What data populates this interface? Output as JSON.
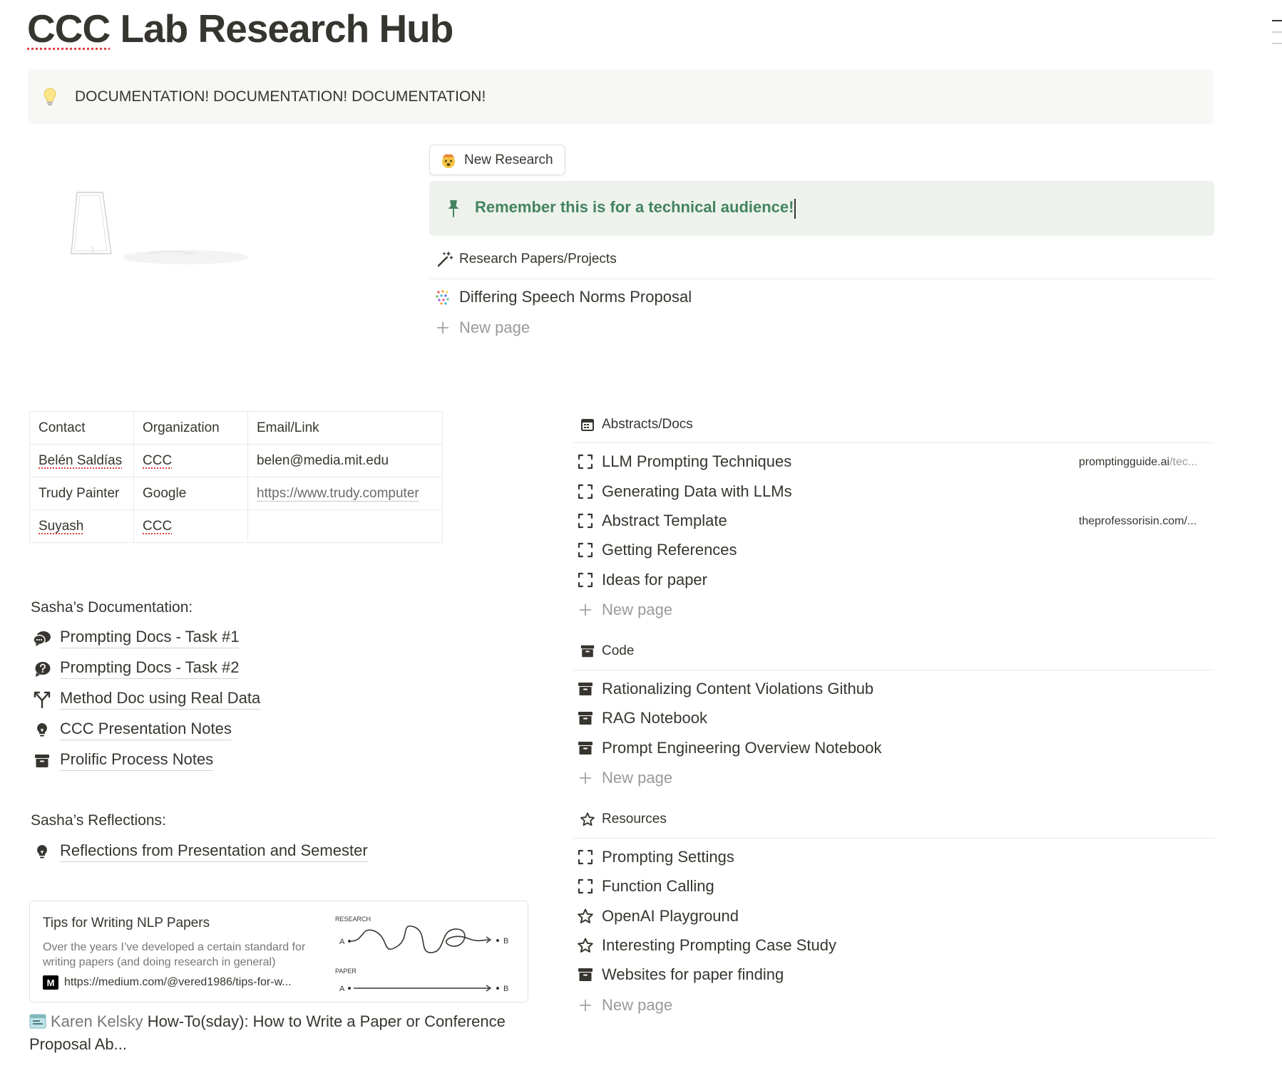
{
  "page": {
    "title_first_word": "CCC",
    "title_rest": " Lab Research Hub"
  },
  "callout_doc": {
    "icon": "lightbulb-icon",
    "text": "DOCUMENTATION! DOCUMENTATION! DOCUMENTATION!"
  },
  "new_research_button": {
    "icon": "exploding-head-emoji-icon",
    "label": "New Research"
  },
  "callout_note": {
    "icon": "pushpin-icon",
    "text": "Remember this is for a technical audience!",
    "color": "#448361",
    "background": "#edf3ec"
  },
  "research_papers": {
    "header": "Research Papers/Projects",
    "icon": "magic-wand-icon",
    "items": [
      {
        "label": "Differing Speech Norms Proposal",
        "icon": "colorful-dots-icon"
      }
    ],
    "new_page_label": "New page"
  },
  "contacts_table": {
    "headers": [
      "Contact",
      "Organization",
      "Email/Link"
    ],
    "rows": [
      [
        "Belén Saldías",
        "CCC",
        "belen@media.mit.edu"
      ],
      [
        "Trudy Painter",
        "Google",
        "https://www.trudy.computer"
      ],
      [
        "Suyash",
        "CCC",
        ""
      ]
    ]
  },
  "sasha_docs": {
    "label": "Sasha’s Documentation:",
    "items": [
      {
        "label": "Prompting Docs - Task #1",
        "icon": "chat-bubbles-icon"
      },
      {
        "label": "Prompting Docs - Task #2",
        "icon": "question-bubble-icon"
      },
      {
        "label": "Method Doc using Real Data",
        "icon": "fork-arrow-icon"
      },
      {
        "label": "CCC Presentation Notes",
        "icon": "lightbulb-icon"
      },
      {
        "label": "Prolific Process Notes",
        "icon": "archive-box-icon"
      }
    ]
  },
  "sasha_reflections": {
    "label": "Sasha’s Reflections:",
    "items": [
      {
        "label": "Reflections from Presentation and Semester",
        "icon": "lightbulb-icon"
      }
    ]
  },
  "bookmark": {
    "title": "Tips for Writing NLP Papers",
    "description": "Over the years I’ve developed a certain standard for writing papers (and doing research in general)",
    "favicon": "M",
    "url": "https://medium.com/@vered1986/tips-for-w...",
    "image_label_research": "RESEARCH",
    "image_label_paper": "PAPER",
    "point_a": "A",
    "point_b": "B"
  },
  "mention": {
    "icon": "calendar-page-icon",
    "author": "Karen Kelsky",
    "title": "How-To(sday): How to Write a Paper or Conference Proposal Ab..."
  },
  "abstracts": {
    "header": "Abstracts/Docs",
    "icon": "calendar-icon",
    "items": [
      {
        "label": "LLM Prompting Techniques",
        "icon": "dashed-square-icon",
        "link_main": "promptingguide.ai",
        "link_faded": "/tec..."
      },
      {
        "label": "Generating Data with LLMs",
        "icon": "dashed-square-icon"
      },
      {
        "label": "Abstract Template",
        "icon": "dashed-square-icon",
        "link_main": "theprofessorisin.com/...",
        "link_faded": ""
      },
      {
        "label": "Getting References",
        "icon": "dashed-square-icon"
      },
      {
        "label": "Ideas for paper",
        "icon": "dashed-square-icon"
      }
    ],
    "new_page_label": "New page"
  },
  "code": {
    "header": "Code",
    "icon": "archive-box-icon",
    "items": [
      {
        "label": "Rationalizing Content Violations Github",
        "icon": "archive-box-icon"
      },
      {
        "label": "RAG Notebook",
        "icon": "archive-box-icon"
      },
      {
        "label": "Prompt Engineering Overview Notebook",
        "icon": "archive-box-icon"
      }
    ],
    "new_page_label": "New page"
  },
  "resources": {
    "header": "Resources",
    "icon": "star-icon",
    "items": [
      {
        "label": "Prompting Settings",
        "icon": "dashed-square-icon"
      },
      {
        "label": "Function Calling",
        "icon": "dashed-square-icon"
      },
      {
        "label": "OpenAI Playground",
        "icon": "star-icon"
      },
      {
        "label": "Interesting Prompting Case Study",
        "icon": "star-icon"
      },
      {
        "label": "Websites for paper finding",
        "icon": "archive-box-icon"
      }
    ],
    "new_page_label": "New page"
  }
}
